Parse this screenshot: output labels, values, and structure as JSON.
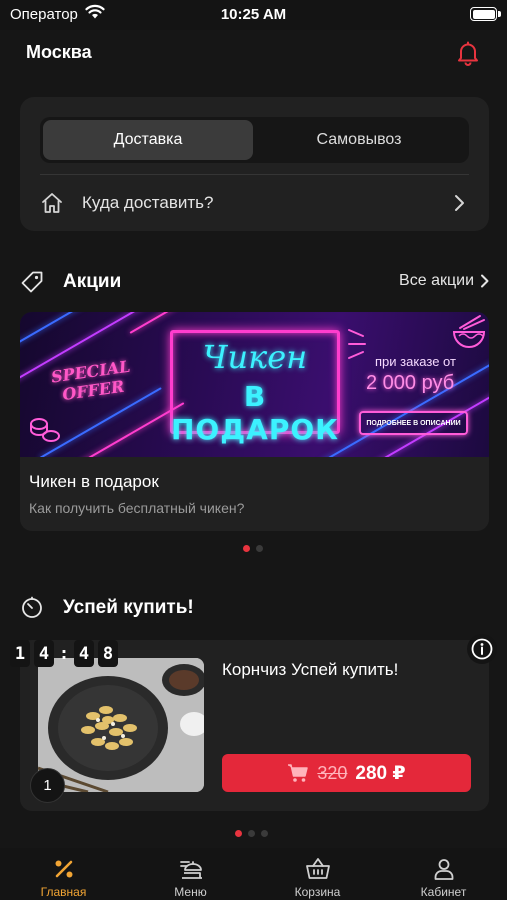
{
  "status_bar": {
    "carrier": "Оператор",
    "time": "10:25 AM"
  },
  "header": {
    "city": "Москва"
  },
  "delivery": {
    "modes": [
      "Доставка",
      "Самовывоз"
    ],
    "selected_mode": "Доставка",
    "address_placeholder": "Куда доставить?"
  },
  "promotions": {
    "title": "Акции",
    "all_label": "Все акции",
    "banner": {
      "special_offer": "SPECIAL OFFER",
      "headline_line1": "Чикен",
      "headline_line2": "В ПОДАРОК",
      "order_note": "при заказе от",
      "order_amount": "2 000 руб",
      "details_button": "ПОДРОБНЕЕ В ОПИСАНИИ"
    },
    "item_title": "Чикен в подарок",
    "item_subtitle": "Как получить бесплатный чикен?",
    "carousel_pages": 2,
    "carousel_active": 1
  },
  "hurry": {
    "title": "Успей купить!",
    "timer": {
      "minutes": [
        "1",
        "4"
      ],
      "separator": ":",
      "seconds": [
        "4",
        "8"
      ]
    },
    "product": {
      "name": "Корнчиз Успей купить!",
      "quantity": "1",
      "old_price": "320",
      "new_price": "280 ₽"
    },
    "carousel_pages": 3,
    "carousel_active": 1
  },
  "tabbar": {
    "items": [
      {
        "label": "Главная",
        "icon": "percent-icon",
        "active": true
      },
      {
        "label": "Меню",
        "icon": "menu-dish-icon",
        "active": false
      },
      {
        "label": "Корзина",
        "icon": "basket-icon",
        "active": false
      },
      {
        "label": "Кабинет",
        "icon": "user-icon",
        "active": false
      }
    ]
  },
  "colors": {
    "accent_red": "#e4283a",
    "accent_orange": "#f2a534",
    "card_bg": "#212121",
    "page_bg": "#161616"
  }
}
